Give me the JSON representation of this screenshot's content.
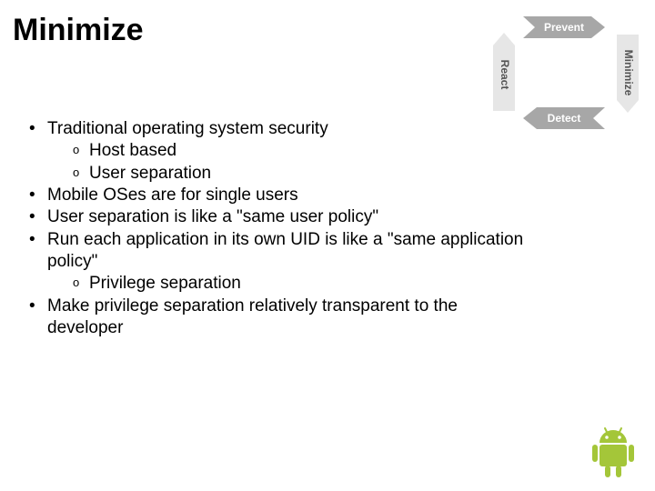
{
  "title": "Minimize",
  "diagram": {
    "top": "Prevent",
    "right": "Minimize",
    "bottom": "Detect",
    "left": "React"
  },
  "bullets": [
    {
      "text": "Traditional operating system security",
      "sub": [
        "Host based",
        "User separation"
      ]
    },
    {
      "text": "Mobile OSes are for single users"
    },
    {
      "text": "User separation is like a \"same user policy\""
    },
    {
      "text": "Run each application in its own UID is like a \"same application policy\"",
      "sub": [
        "Privilege separation"
      ]
    },
    {
      "text": "Make privilege separation relatively transparent to the developer"
    }
  ],
  "logo": "android"
}
